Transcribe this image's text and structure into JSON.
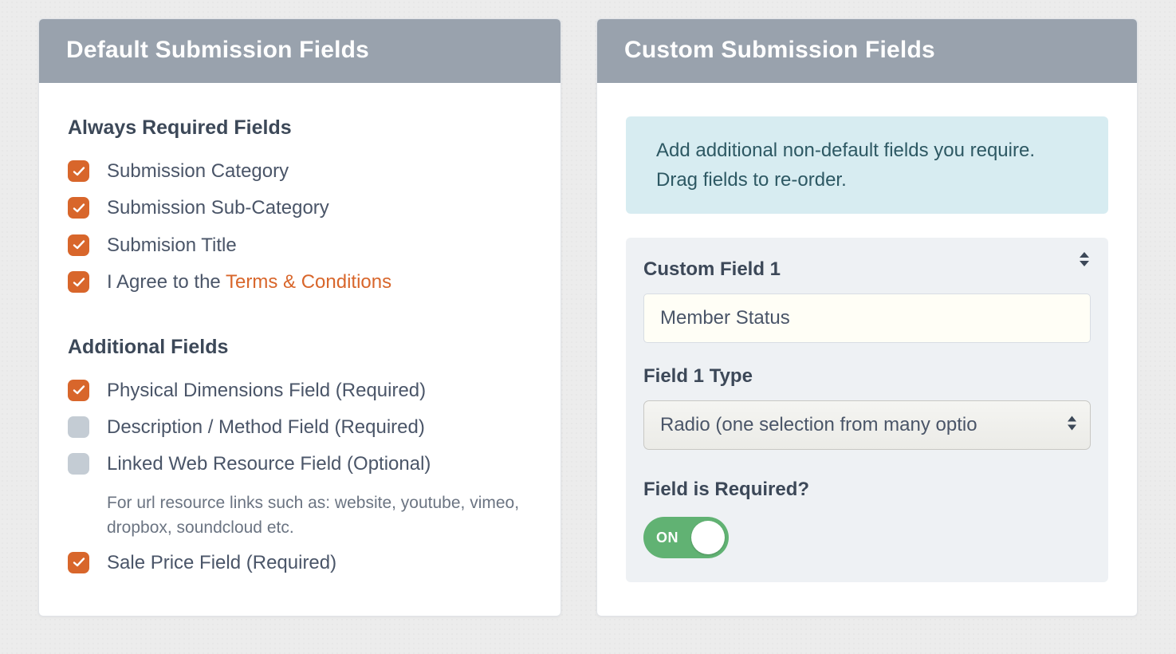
{
  "left": {
    "title": "Default Submission Fields",
    "always_required_title": "Always Required Fields",
    "always_required": [
      {
        "label": "Submission Category",
        "checked": true
      },
      {
        "label": "Submission Sub-Category",
        "checked": true
      },
      {
        "label": "Submision Title",
        "checked": true
      },
      {
        "label_prefix": "I Agree to the ",
        "link_text": "Terms & Conditions",
        "checked": true
      }
    ],
    "additional_title": "Additional Fields",
    "additional": [
      {
        "label": "Physical Dimensions Field (Required)",
        "checked": true
      },
      {
        "label": "Description / Method Field (Required)",
        "checked": false
      },
      {
        "label": "Linked Web Resource Field (Optional)",
        "checked": false,
        "sub": "For url resource links such as: website, youtube, vimeo, dropbox, soundcloud etc."
      },
      {
        "label": "Sale Price Field (Required)",
        "checked": true
      }
    ]
  },
  "right": {
    "title": "Custom Submission Fields",
    "info": "Add additional non-default fields you require. Drag fields to re-order.",
    "cf1_label": "Custom Field 1",
    "cf1_value": "Member Status",
    "cf1_type_label": "Field 1 Type",
    "cf1_type_value": "Radio (one selection from many optio",
    "required_label": "Field is Required?",
    "toggle_state": "ON"
  }
}
